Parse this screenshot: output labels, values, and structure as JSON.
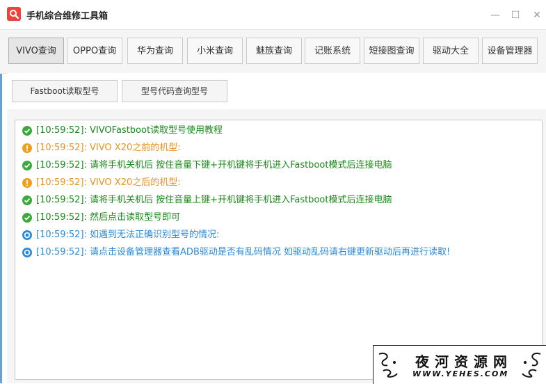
{
  "window": {
    "title": "手机综合维修工具箱",
    "controls": {
      "minimize": "—",
      "maximize": "☐",
      "close": "✕"
    }
  },
  "tabs": [
    {
      "label": "VIVO查询",
      "active": true
    },
    {
      "label": "OPPO查询",
      "active": false
    },
    {
      "label": "华为查询",
      "active": false
    },
    {
      "label": "小米查询",
      "active": false
    },
    {
      "label": "魅族查询",
      "active": false
    },
    {
      "label": "记账系统",
      "active": false
    },
    {
      "label": "短接图查询",
      "active": false
    },
    {
      "label": "驱动大全",
      "active": false
    },
    {
      "label": "设备管理器",
      "active": false
    }
  ],
  "actions": {
    "fastboot_read": "Fastboot读取型号",
    "model_code_query": "型号代码查询型号"
  },
  "log": [
    {
      "type": "success",
      "text": "[10:59:52]: VIVOFastboot读取型号使用教程"
    },
    {
      "type": "warning",
      "text": "[10:59:52]: VIVO X20之前的机型:"
    },
    {
      "type": "success",
      "text": "[10:59:52]: 请将手机关机后 按住音量下键+开机键将手机进入Fastboot模式后连接电脑"
    },
    {
      "type": "warning",
      "text": "[10:59:52]: VIVO X20之后的机型:"
    },
    {
      "type": "success",
      "text": "[10:59:52]: 请将手机关机后 按住音量上键+开机键将手机进入Fastboot模式后连接电脑"
    },
    {
      "type": "success",
      "text": "[10:59:52]: 然后点击读取型号即可"
    },
    {
      "type": "info",
      "text": "[10:59:52]: 如遇到无法正确识别型号的情况:"
    },
    {
      "type": "info",
      "text": "[10:59:52]: 请点击设备管理器查看ADB驱动是否有乱码情况 如驱动乱码请右键更新驱动后再进行读取!"
    }
  ],
  "watermark": {
    "main": "夜河资源网",
    "sub": "WWW.YEHES.COM"
  },
  "colors": {
    "success": "#1a8a1a",
    "warning": "#e8921e",
    "info": "#2b8ad8",
    "app_icon": "#e8453c"
  }
}
